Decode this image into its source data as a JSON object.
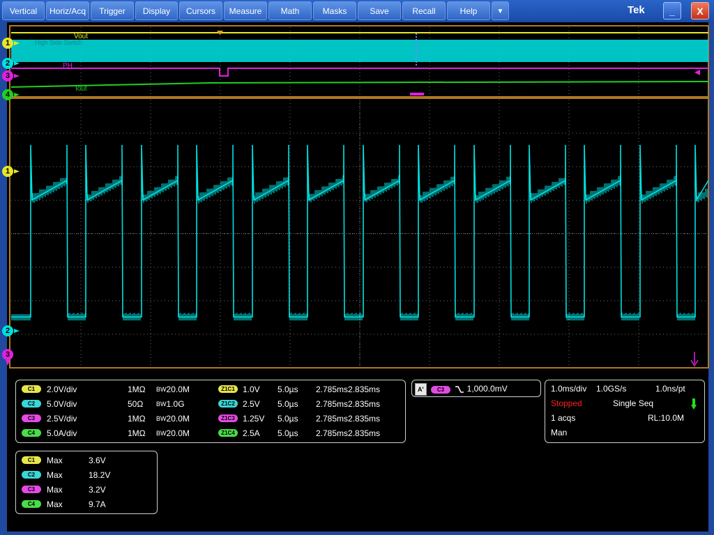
{
  "menu": {
    "items": [
      "Vertical",
      "Horiz/Acq",
      "Trigger",
      "Display",
      "Cursors",
      "Measure",
      "Math",
      "Masks",
      "Save",
      "Recall",
      "Help"
    ],
    "more_label": "▼"
  },
  "window": {
    "brand": "Tek",
    "minimize_label": "_",
    "close_label": "X"
  },
  "zoom_traces": {
    "labels": [
      "Vout",
      "High Side Switch",
      "PH",
      "Iout"
    ],
    "colors": [
      "#e6e62a",
      "#00e0e0",
      "#e020e0",
      "#20d020"
    ]
  },
  "markers": {
    "ch1_top": "1",
    "ch2_top": "2",
    "ch3_top": "3",
    "ch4_top": "4",
    "ch1_main": "1",
    "ch2_main": "2",
    "ch3_main": "3"
  },
  "channels": [
    {
      "badge": "C1",
      "scale": "2.0V/div",
      "imp": "1MΩ",
      "bw": "20.0M",
      "zbadge": "Z1C1",
      "zscale": "1.0V",
      "ztime": "5.0µs",
      "zpos": "2.785ms2.835ms"
    },
    {
      "badge": "C2",
      "scale": "5.0V/div",
      "imp": "50Ω",
      "bw": "1.0G",
      "zbadge": "Z1C2",
      "zscale": "2.5V",
      "ztime": "5.0µs",
      "zpos": "2.785ms2.835ms"
    },
    {
      "badge": "C3",
      "scale": "2.5V/div",
      "imp": "1MΩ",
      "bw": "20.0M",
      "zbadge": "Z1C3",
      "zscale": "1.25V",
      "ztime": "5.0µs",
      "zpos": "2.785ms2.835ms"
    },
    {
      "badge": "C4",
      "scale": "5.0A/div",
      "imp": "1MΩ",
      "bw": "20.0M",
      "zbadge": "Z1C4",
      "zscale": "2.5A",
      "ztime": "5.0µs",
      "zpos": "2.785ms2.835ms"
    }
  ],
  "bw_prefix": "B",
  "bw_sub": "W",
  "trigger": {
    "source_badge": "A'",
    "channel_badge": "C3",
    "slope_icon": "falling-edge-icon",
    "level": "1,000.0mV"
  },
  "acq": {
    "timebase": "1.0ms/div",
    "sample_rate": "1.0GS/s",
    "resolution": "1.0ns/pt",
    "state": "Stopped",
    "mode": "Single Seq",
    "acqs": "1 acqs",
    "record_length": "RL:10.0M",
    "trigger_mode": "Man"
  },
  "measurements": [
    {
      "badge": "C1",
      "type": "Max",
      "value": "3.6V"
    },
    {
      "badge": "C2",
      "type": "Max",
      "value": "18.2V"
    },
    {
      "badge": "C3",
      "type": "Max",
      "value": "3.2V"
    },
    {
      "badge": "C4",
      "type": "Max",
      "value": "9.7A"
    }
  ],
  "colors": {
    "ch1": "#e6e62a",
    "ch2": "#00e0e0",
    "ch3": "#e020e0",
    "ch4": "#20d020",
    "stopped": "#ff2020",
    "grid": "#808080"
  }
}
